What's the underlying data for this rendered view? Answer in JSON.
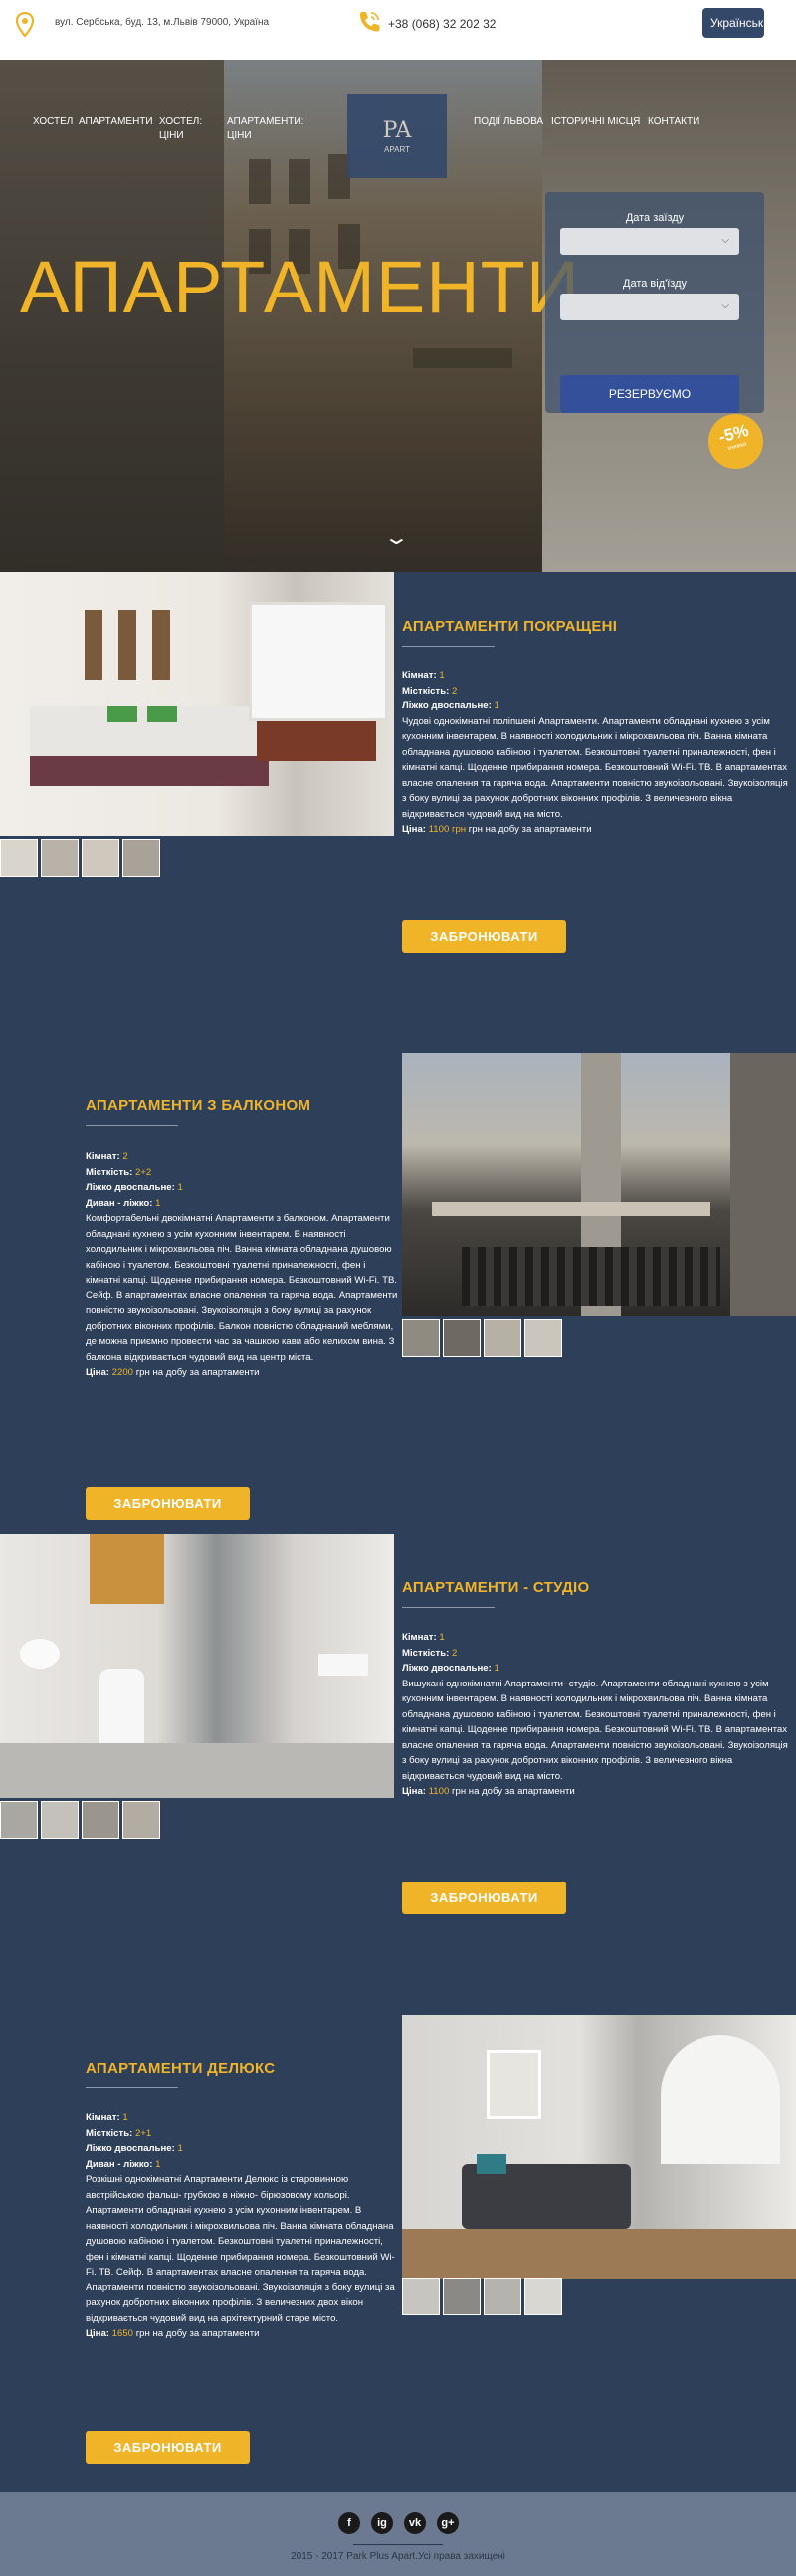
{
  "header": {
    "address": "вул. Сербська, буд. 13, м.Львів 79000, Україна",
    "phone": "+38 (068) 32 202 32",
    "language": "Українська"
  },
  "nav": {
    "items": [
      "ХОСТЕЛ",
      "АПАРТАМЕНТИ",
      "ХОСТЕЛ: ЦІНИ",
      "АПАРТАМЕНТИ: ЦІНИ",
      "ПОДІЇ ЛЬВОВА",
      "ІСТОРИЧНІ МІСЦЯ",
      "КОНТАКТИ"
    ],
    "logo_mark": "PA",
    "logo_text": "APART"
  },
  "hero": {
    "title": "АПАРТАМЕНТИ",
    "checkin_label": "Дата заїзду",
    "checkout_label": "Дата від'їзду",
    "reserve_button": "РЕЗЕРВУЄМО",
    "discount": "-5%",
    "discount_sub": "знижка"
  },
  "rooms": [
    {
      "title": "АПАРТАМЕНТИ ПОКРАЩЕНІ",
      "specs": [
        {
          "label": "Кімнат:",
          "value": "1"
        },
        {
          "label": "Місткість:",
          "value": "2"
        },
        {
          "label": "Ліжко двоспальне:",
          "value": "1"
        }
      ],
      "text": "Чудові однокімнатні поліпшені Апартаменти. Апартаменти обладнані кухнею з усім кухонним інвентарем. В наявності холодильник і мікрохвильова піч. Ванна кімната обладнана душовою кабіною і туалетом. Безкоштовні туалетні приналежності, фен і кімнатні капці. Щоденне прибирання номера. Безкоштовний Wi-Fi. ТВ. В апартаментах власне опалення та гаряча вода. Апартаменти повністю звукоізольовані. Звукоізоляція з боку вулиці за рахунок добротних віконних профілів. З величезного вікна відкривається чудовий вид на місто.",
      "price_label": "Ціна:",
      "price_value": "1100 грн",
      "price_suffix": "грн на добу за апартаменти",
      "button": "ЗАБРОНЮВАТИ"
    },
    {
      "title": "АПАРТАМЕНТИ З БАЛКОНОМ",
      "specs": [
        {
          "label": "Кімнат:",
          "value": "2"
        },
        {
          "label": "Місткість:",
          "value": "2+2"
        },
        {
          "label": "Ліжко двоспальне:",
          "value": "1"
        },
        {
          "label": "Диван - ліжко:",
          "value": "1"
        }
      ],
      "text": "Комфортабельні двокімнатні Апартаменти з балконом. Апартаменти обладнані кухнею з усім кухонним інвентарем. В наявності холодильник і мікрохвильова піч. Ванна кімната обладнана душовою кабіною і туалетом. Безкоштовні туалетні приналежності, фен і кімнатні капці. Щоденне прибирання номера. Безкоштовний Wi-Fi. ТВ. Сейф. В апартаментах власне опалення та гаряча вода. Апартаменти повністю звукоізольовані. Звукоізоляція з боку вулиці за рахунок добротних віконних профілів. Балкон повністю обладнаний меблями, де можна приємно провести час за чашкою кави або келихом вина. З балкона відкривається чудовий вид на центр міста.",
      "price_label": "Ціна:",
      "price_value": "2200",
      "price_suffix": "грн на добу за апартаменти",
      "button": "ЗАБРОНЮВАТИ"
    },
    {
      "title": "АПАРТАМЕНТИ - СТУДІО",
      "specs": [
        {
          "label": "Кімнат:",
          "value": "1"
        },
        {
          "label": "Місткість:",
          "value": "2"
        },
        {
          "label": "Ліжко двоспальне:",
          "value": "1"
        }
      ],
      "text": "Вишукані однокімнатні Апартаменти- студіо. Апартаменти обладнані кухнею з усім кухонним інвентарем. В наявності холодильник і мікрохвильова піч. Ванна кімната обладнана душовою кабіною і туалетом. Безкоштовні туалетні приналежності, фен і кімнатні капці. Щоденне прибирання номера. Безкоштовний Wi-Fi. ТВ. В апартаментах власне опалення та гаряча вода. Апартаменти повністю звукоізольовані. Звукоізоляція з боку вулиці за рахунок добротних віконних профілів. З величезного вікна відкривається чудовий вид на місто.",
      "price_label": "Ціна:",
      "price_value": "1100",
      "price_suffix": "грн на добу за апартаменти",
      "button": "ЗАБРОНЮВАТИ"
    },
    {
      "title": "АПАРТАМЕНТИ ДЕЛЮКС",
      "specs": [
        {
          "label": "Кімнат:",
          "value": "1"
        },
        {
          "label": "Місткість:",
          "value": "2+1"
        },
        {
          "label": "Ліжко двоспальне:",
          "value": "1"
        },
        {
          "label": "Диван - ліжко:",
          "value": "1"
        }
      ],
      "text": "Розкішні однокімнатні Апартаменти Делюкс із старовинною австрійською фальш- грубкою в ніжно- бірюзовому кольорі. Апартаменти обладнані кухнею з усім кухонним інвентарем. В наявності холодильник і мікрохвильова піч. Ванна кімната обладнана душовою кабіною і туалетом. Безкоштовні туалетні приналежності, фен і кімнатні капці. Щоденне прибирання номера. Безкоштовний Wi-Fi. ТВ. Сейф. В апартаментах власне опалення та гаряча вода. Апартаменти повністю звукоізольовані. Звукоізоляція з боку вулиці за рахунок добротних віконних профілів. З величезних двох вікон відкривається чудовий вид на архітектурний старе місто.",
      "price_label": "Ціна:",
      "price_value": "1650",
      "price_suffix": "грн на добу за апартаменти",
      "button": "ЗАБРОНЮВАТИ"
    }
  ],
  "footer": {
    "social": [
      "f",
      "ig",
      "vk",
      "g+"
    ],
    "copyright": "2015 - 2017 Park Plus Apart.Усі права захищені"
  },
  "colors": {
    "accent": "#f0b429",
    "background": "#2e3f59",
    "button_blue": "#34509a"
  }
}
